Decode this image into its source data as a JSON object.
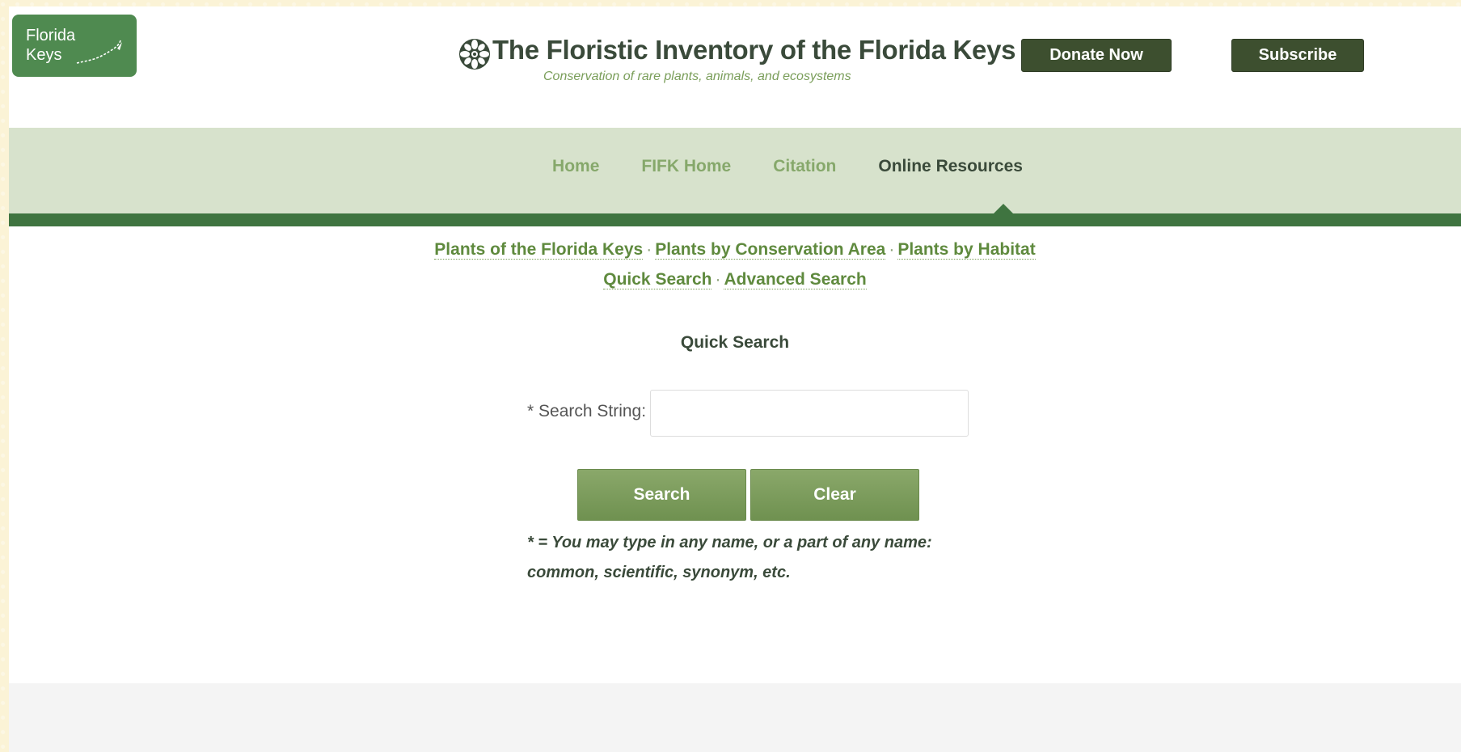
{
  "logo": {
    "line1": "Florida",
    "line2": "Keys"
  },
  "header": {
    "title": "The Floristic Inventory of the Florida Keys",
    "subtitle": "Conservation of rare plants, animals, and ecosystems",
    "donate_label": "Donate Now",
    "subscribe_label": "Subscribe"
  },
  "nav": {
    "items": [
      {
        "label": "Home"
      },
      {
        "label": "FIFK Home"
      },
      {
        "label": "Citation"
      },
      {
        "label": "Online Resources"
      }
    ],
    "active": "Online Resources"
  },
  "sublinks": {
    "row1": [
      "Plants of the Florida Keys",
      "Plants by Conservation Area",
      "Plants by Habitat"
    ],
    "row2": [
      "Quick Search",
      "Advanced Search"
    ],
    "separator": "·"
  },
  "search": {
    "title": "Quick Search",
    "label": "* Search String:",
    "value": "",
    "search_button": "Search",
    "clear_button": "Clear",
    "note_line1": "* = You may type in any name, or a part of any name:",
    "note_line2": "common, scientific, synonym, etc."
  },
  "colors": {
    "brand_green": "#4f8a50",
    "nav_bg": "#d7e2cc",
    "nav_bar": "#3f7440",
    "header_button": "#3d4f2f",
    "action_button": "#7a9a5a",
    "link": "#5f8a3e"
  },
  "icons": {
    "title_icon": "flower-icon",
    "logo_art": "keys-map-icon"
  }
}
